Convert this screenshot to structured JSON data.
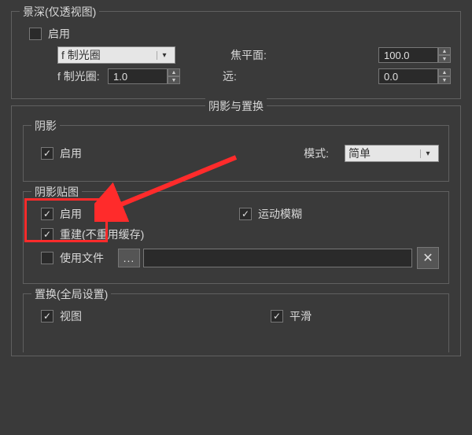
{
  "dof": {
    "title": "景深(仅透视图)",
    "enable_label": "启用",
    "enable_checked": false,
    "aperture_select_label": "f 制光圈",
    "focal_plane_label": "焦平面:",
    "focal_plane_value": "100.0",
    "fstop_label": "f 制光圈:",
    "fstop_value": "1.0",
    "far_label": "远:",
    "far_value": "0.0"
  },
  "shadow_section": {
    "header": "阴影与置换",
    "shadow": {
      "title": "阴影",
      "enable_label": "启用",
      "enable_checked": true,
      "mode_label": "模式:",
      "mode_value": "简单"
    },
    "shadowmap": {
      "title": "阴影贴图",
      "enable_label": "启用",
      "enable_checked": true,
      "motion_blur_label": "运动模糊",
      "motion_blur_checked": true,
      "rebuild_label": "重建(不重用缓存)",
      "rebuild_checked": true,
      "usefile_label": "使用文件",
      "usefile_checked": false,
      "browse_btn": "...",
      "filepath": ""
    },
    "displacement": {
      "title": "置换(全局设置)",
      "view_label": "视图",
      "view_checked": true,
      "smooth_label": "平滑",
      "smooth_checked": true
    }
  }
}
